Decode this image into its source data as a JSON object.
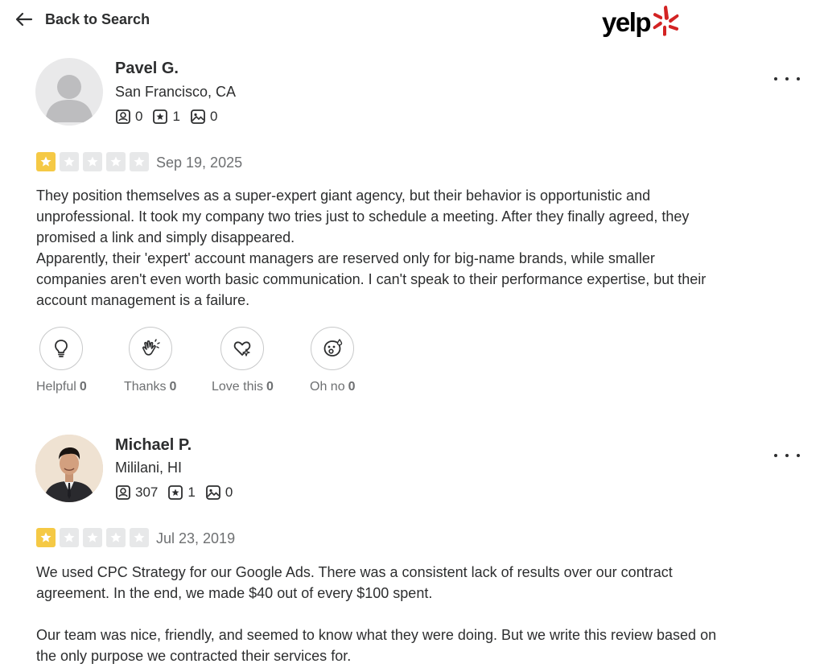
{
  "header": {
    "back_label": "Back to Search",
    "logo_text": "yelp",
    "brand_color": "#d32323"
  },
  "reviews": [
    {
      "user": {
        "name": "Pavel G.",
        "location": "San Francisco, CA",
        "friends": "0",
        "reviews": "1",
        "photos": "0"
      },
      "rating": 1,
      "date": "Sep 19, 2025",
      "paragraphs": [
        "They position themselves as a super-expert giant agency, but their behavior is opportunistic and unprofessional. It took my company two tries just to schedule a meeting. After they finally agreed, they promised a link and simply disappeared.",
        "Apparently, their 'expert' account managers are reserved only for big-name brands, while smaller companies aren't even worth basic communication. I can't speak to their performance expertise, but their account management is a failure."
      ],
      "reactions": [
        {
          "label": "Helpful",
          "count": "0",
          "icon": "lightbulb-icon"
        },
        {
          "label": "Thanks",
          "count": "0",
          "icon": "clapping-hands-icon"
        },
        {
          "label": "Love this",
          "count": "0",
          "icon": "heart-sparkle-icon"
        },
        {
          "label": "Oh no",
          "count": "0",
          "icon": "surprised-face-icon"
        }
      ]
    },
    {
      "user": {
        "name": "Michael P.",
        "location": "Mililani, HI",
        "friends": "307",
        "reviews": "1",
        "photos": "0"
      },
      "rating": 1,
      "date": "Jul 23, 2019",
      "paragraphs": [
        "We used CPC Strategy for our Google Ads. There was a consistent lack of results over our contract agreement. In the end, we made $40 out of every $100 spent.",
        "Our team was nice, friendly, and seemed to know what they were doing. But we write this review based on the only purpose we contracted their services for."
      ]
    }
  ],
  "colors": {
    "star_filled": "#f5c945",
    "star_empty": "#e7e8e9",
    "text": "#2d2e2f",
    "muted": "#6e7072"
  }
}
